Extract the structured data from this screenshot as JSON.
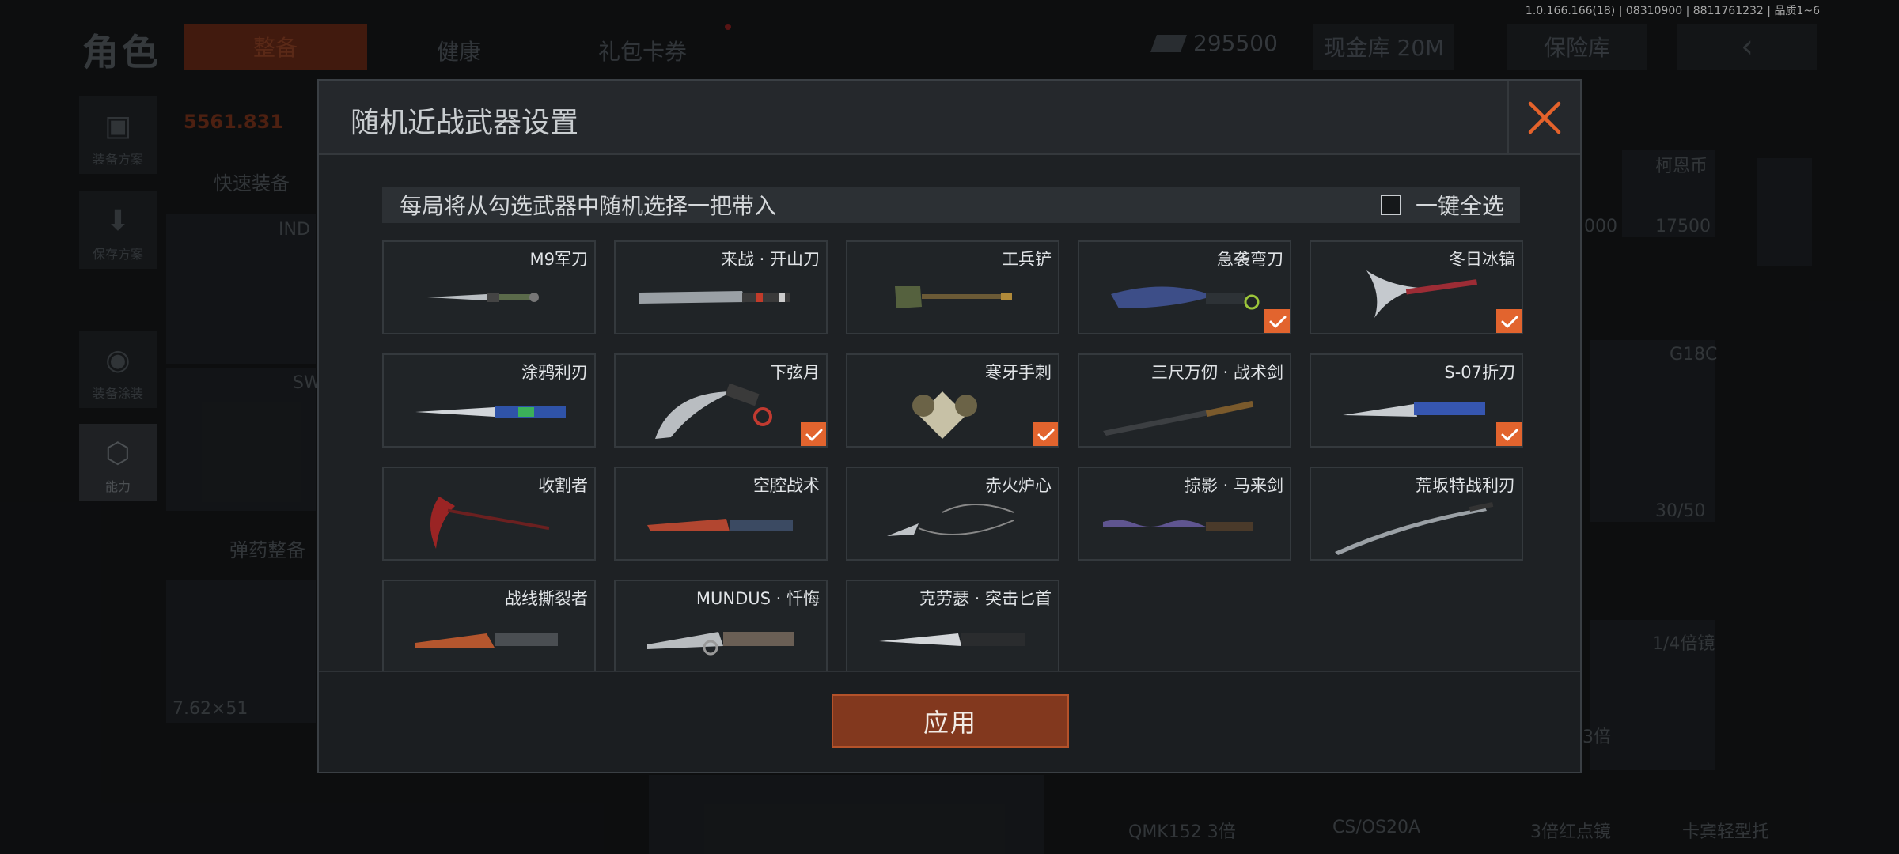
{
  "version_text": "1.0.166.166(18) | 08310900 | 8811761232 | 品质1~6",
  "background": {
    "title": "角色",
    "tabs": [
      "整备",
      "健康",
      "礼包卡券"
    ],
    "money": "295500",
    "cash_vault": "现金库 20M",
    "safe_box": "保险库",
    "back_icon": "‹",
    "side_buttons": [
      "装备方案",
      "保存方案",
      "装备涂装",
      "能力"
    ],
    "quick_equip": "快速装备",
    "ammo_equip": "弹药整备",
    "orange_value": "5561.831",
    "labels": [
      "IND",
      "SW",
      "7.62×51",
      "柯恩币",
      "17500",
      "000",
      "G18C",
      "30/50",
      "1/4倍镜",
      "3倍",
      "QMK152 3倍",
      "CS/OS20A",
      "3倍红点镜",
      "卡宾轻型托"
    ]
  },
  "modal": {
    "title": "随机近战武器设置",
    "info_text": "每局将从勾选武器中随机选择一把带入",
    "select_all_label": "一键全选",
    "apply_label": "应用",
    "colors": {
      "accent": "#e2642e",
      "apply_bg": "#82381e"
    },
    "weapons": [
      {
        "name": "M9军刀",
        "checked": false,
        "icon": "bayonet-icon"
      },
      {
        "name": "来战 · 开山刀",
        "checked": false,
        "icon": "machete-icon"
      },
      {
        "name": "工兵铲",
        "checked": false,
        "icon": "shovel-icon"
      },
      {
        "name": "急袭弯刀",
        "checked": true,
        "icon": "curved-blade-icon"
      },
      {
        "name": "冬日冰镐",
        "checked": true,
        "icon": "ice-axe-icon"
      },
      {
        "name": "涂鸦利刃",
        "checked": false,
        "icon": "graffiti-knife-icon"
      },
      {
        "name": "下弦月",
        "checked": true,
        "icon": "karambit-icon"
      },
      {
        "name": "寒牙手刺",
        "checked": true,
        "icon": "push-dagger-icon"
      },
      {
        "name": "三尺万仞 · 战术剑",
        "checked": false,
        "icon": "tactical-sword-icon"
      },
      {
        "name": "S-07折刀",
        "checked": true,
        "icon": "folding-knife-icon"
      },
      {
        "name": "收割者",
        "checked": false,
        "icon": "scythe-icon"
      },
      {
        "name": "空腔战术",
        "checked": false,
        "icon": "tactical-knife-icon"
      },
      {
        "name": "赤火炉心",
        "checked": false,
        "icon": "chain-blades-icon"
      },
      {
        "name": "掠影 · 马来剑",
        "checked": false,
        "icon": "kris-icon"
      },
      {
        "name": "荒坂特战利刃",
        "checked": false,
        "icon": "katana-icon"
      },
      {
        "name": "战线撕裂者",
        "checked": false,
        "icon": "ripper-knife-icon"
      },
      {
        "name": "MUNDUS · 忏悔",
        "checked": false,
        "icon": "mundus-knife-icon"
      },
      {
        "name": "克劳瑟 · 突击匕首",
        "checked": false,
        "icon": "assault-dagger-icon"
      }
    ]
  }
}
